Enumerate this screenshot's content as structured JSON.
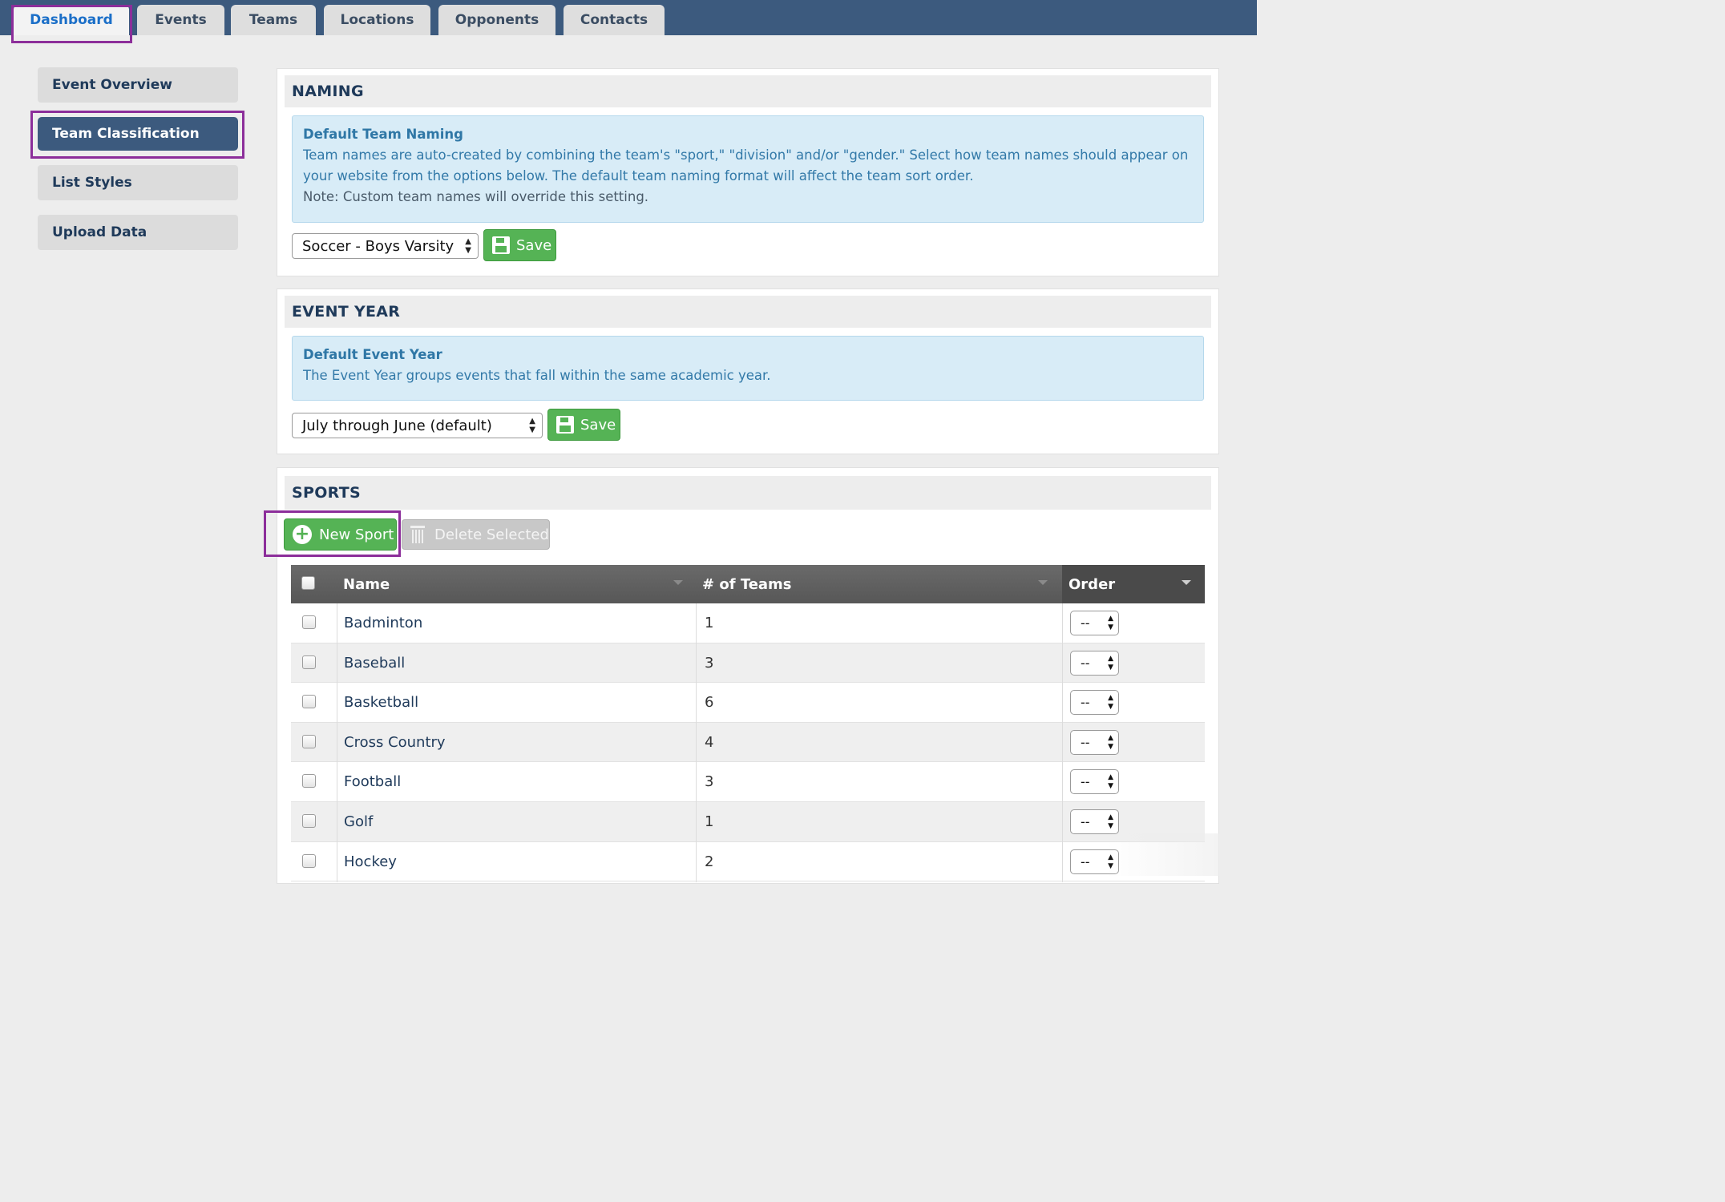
{
  "nav": {
    "tabs": [
      {
        "label": "Dashboard",
        "active": true
      },
      {
        "label": "Events",
        "active": false
      },
      {
        "label": "Teams",
        "active": false
      },
      {
        "label": "Locations",
        "active": false
      },
      {
        "label": "Opponents",
        "active": false
      },
      {
        "label": "Contacts",
        "active": false
      }
    ]
  },
  "sidebar": {
    "items": [
      {
        "label": "Event Overview",
        "active": false
      },
      {
        "label": "Team Classification",
        "active": true
      },
      {
        "label": "List Styles",
        "active": false
      },
      {
        "label": "Upload Data",
        "active": false
      }
    ]
  },
  "naming": {
    "heading": "NAMING",
    "info_title": "Default Team Naming",
    "info_text": "Team names are auto-created by combining the team's \"sport,\" \"division\" and/or \"gender.\" Select how team names should appear on your website from the options below. The default team naming format will affect the team sort order.",
    "info_note": "Note: Custom team names will override this setting.",
    "select_value": "Soccer - Boys Varsity",
    "save_label": "Save"
  },
  "event_year": {
    "heading": "EVENT YEAR",
    "info_title": "Default Event Year",
    "info_text": "The Event Year groups events that fall within the same academic year.",
    "select_value": "July through June (default)",
    "save_label": "Save"
  },
  "sports": {
    "heading": "SPORTS",
    "new_label": "New Sport",
    "delete_label": "Delete Selected",
    "columns": {
      "name": "Name",
      "teams": "# of Teams",
      "order": "Order"
    },
    "order_placeholder": "--",
    "rows": [
      {
        "name": "Badminton",
        "teams": "1"
      },
      {
        "name": "Baseball",
        "teams": "3"
      },
      {
        "name": "Basketball",
        "teams": "6"
      },
      {
        "name": "Cross Country",
        "teams": "4"
      },
      {
        "name": "Football",
        "teams": "3"
      },
      {
        "name": "Golf",
        "teams": "1"
      },
      {
        "name": "Hockey",
        "teams": "2"
      }
    ]
  },
  "colors": {
    "nav_bg": "#3c5a7e",
    "active_tab_text": "#1b6fc8",
    "highlight": "#8c2e9a",
    "save_green": "#55b355",
    "info_bg": "#d8ecf7"
  }
}
